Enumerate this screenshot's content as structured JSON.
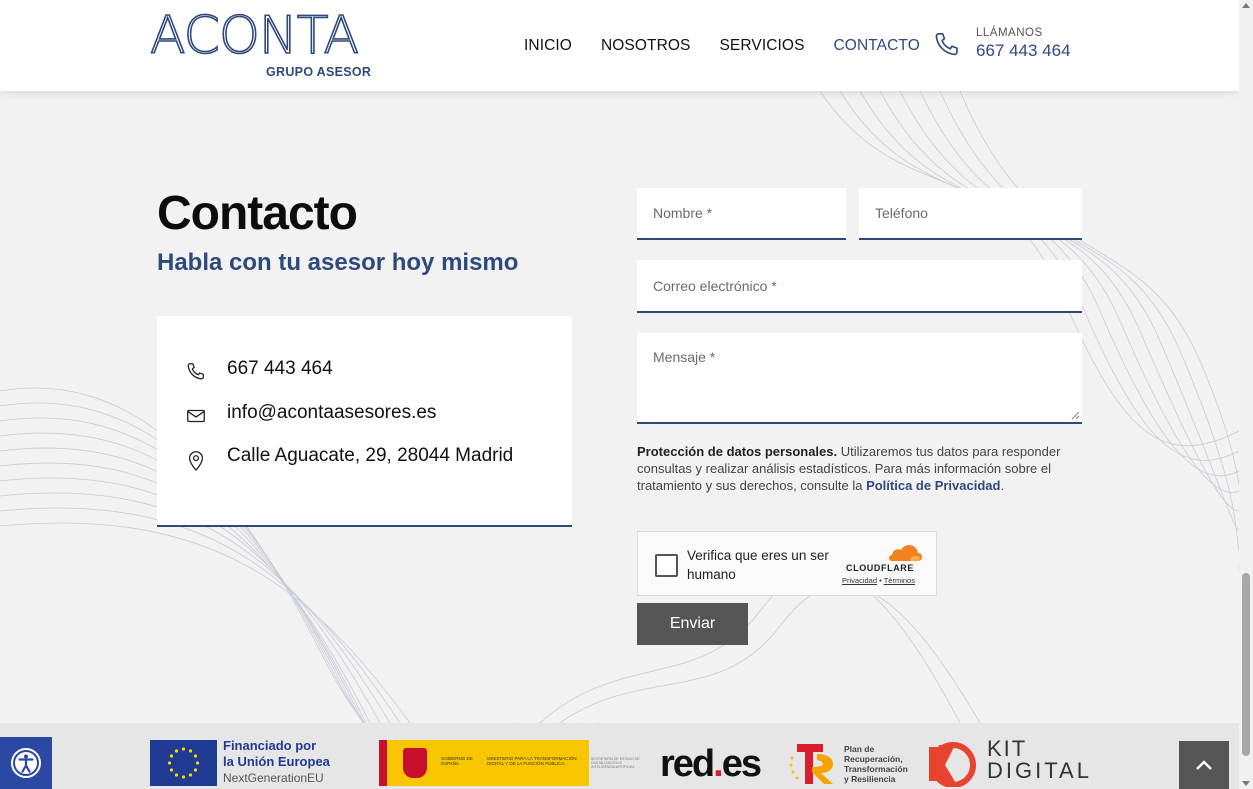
{
  "header": {
    "logo": {
      "word": "ACONTA",
      "sub": "GRUPO ASESOR"
    },
    "nav": [
      {
        "label": "INICIO"
      },
      {
        "label": "NOSOTROS"
      },
      {
        "label": "SERVICIOS"
      },
      {
        "label": "CONTACTO",
        "active": true
      }
    ],
    "call_label": "LLÁMANOS",
    "call_number": "667 443 464",
    "icon": "phone-icon"
  },
  "main": {
    "title": "Contacto",
    "subtitle": "Habla con tu asesor hoy mismo",
    "contact": {
      "phone": "667 443 464",
      "email": "info@acontaasesores.es",
      "address": "Calle Aguacate, 29, 28044 Madrid"
    }
  },
  "form": {
    "name_placeholder": "Nombre *",
    "phone_placeholder": "Teléfono",
    "email_placeholder": "Correo electrónico *",
    "message_placeholder": "Mensaje *",
    "privacy_bold": "Protección de datos personales.",
    "privacy_text": " Utilizaremos tus datos para responder consultas y realizar análisis estadísticos. Para más información sobre el tratamiento y sus derechos, consulte la ",
    "privacy_link": "Política de Privacidad",
    "privacy_end": ".",
    "captcha": {
      "label": "Verifica que eres un ser humano",
      "brand": "CLOUDFLARE",
      "privacy": "Privacidad",
      "sep": " • ",
      "terms": "Términos"
    },
    "submit": "Enviar"
  },
  "footer": {
    "eu_line1": "Financiado por",
    "eu_line2": "la Unión Europea",
    "eu_line3": "NextGenerationEU",
    "gob_text1": "GOBIERNO DE ESPAÑA",
    "gob_text2": "MINISTERIO PARA LA TRANSFORMACIÓN DIGITAL Y DE LA FUNCIÓN PÚBLICA",
    "sec_text": "SECRETARÍA DE ESTADO DE DIGITALIZACIÓN E INTELIGENCIA ARTIFICIAL",
    "reds_main": "red",
    "reds_dot": ".",
    "reds_end": "es",
    "prtr_line1": "Plan de",
    "prtr_line2": "Recuperación,",
    "prtr_line3": "Transformación",
    "prtr_line4": "y Resiliencia",
    "kit_line1": "KIT",
    "kit_line2": "DIGITAL"
  },
  "colors": {
    "brand_blue": "#2e4a7d",
    "button_gray": "#555555",
    "accessibility_blue": "#2b49a3",
    "cloudflare_orange": "#f48120"
  }
}
